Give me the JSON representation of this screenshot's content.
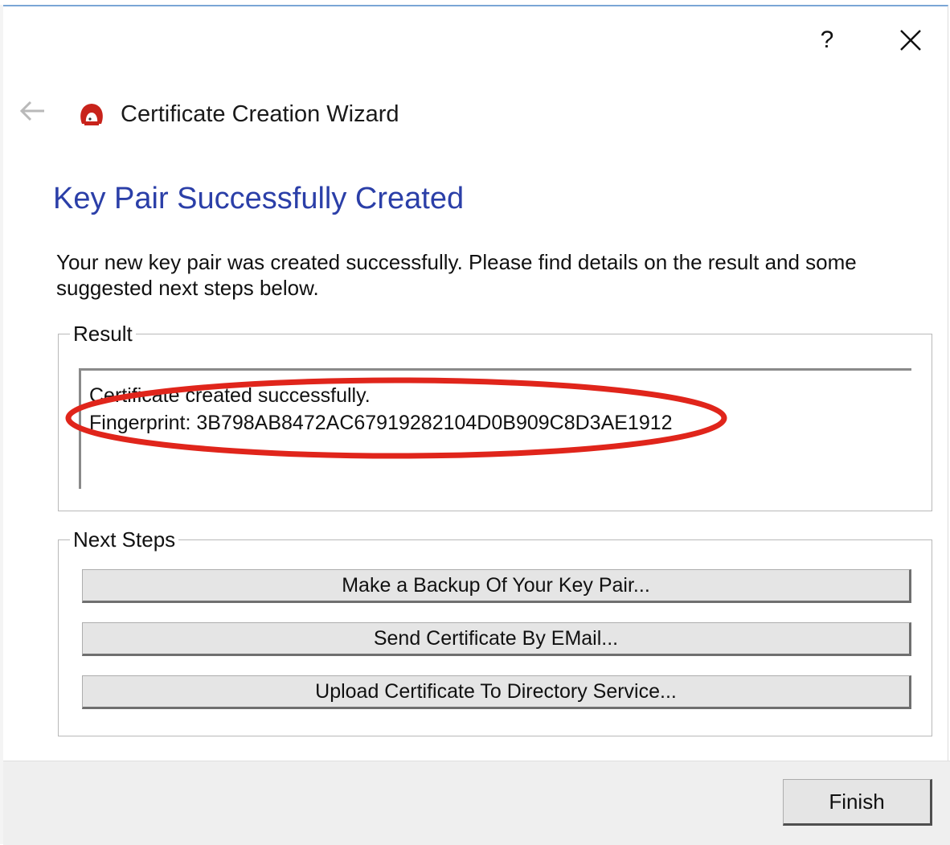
{
  "titlebar": {
    "help_label": "?"
  },
  "header": {
    "title": "Certificate Creation Wizard",
    "app_icon": "kleopatra-icon",
    "back_icon": "back-arrow-icon"
  },
  "page": {
    "heading": "Key Pair Successfully Created",
    "intro": "Your new key pair was created successfully. Please find details on the result and some suggested next steps below."
  },
  "result": {
    "legend": "Result",
    "line1": "Certificate created successfully.",
    "line2": "Fingerprint: 3B798AB8472AC67919282104D0B909C8D3AE1912"
  },
  "next_steps": {
    "legend": "Next Steps",
    "buttons": [
      "Make a Backup Of Your Key Pair...",
      "Send Certificate By EMail...",
      "Upload Certificate To Directory Service..."
    ]
  },
  "footer": {
    "finish_label": "Finish"
  },
  "colors": {
    "heading": "#2b3fa8",
    "annotation": "#e0251b",
    "icon_red": "#c8231b"
  }
}
